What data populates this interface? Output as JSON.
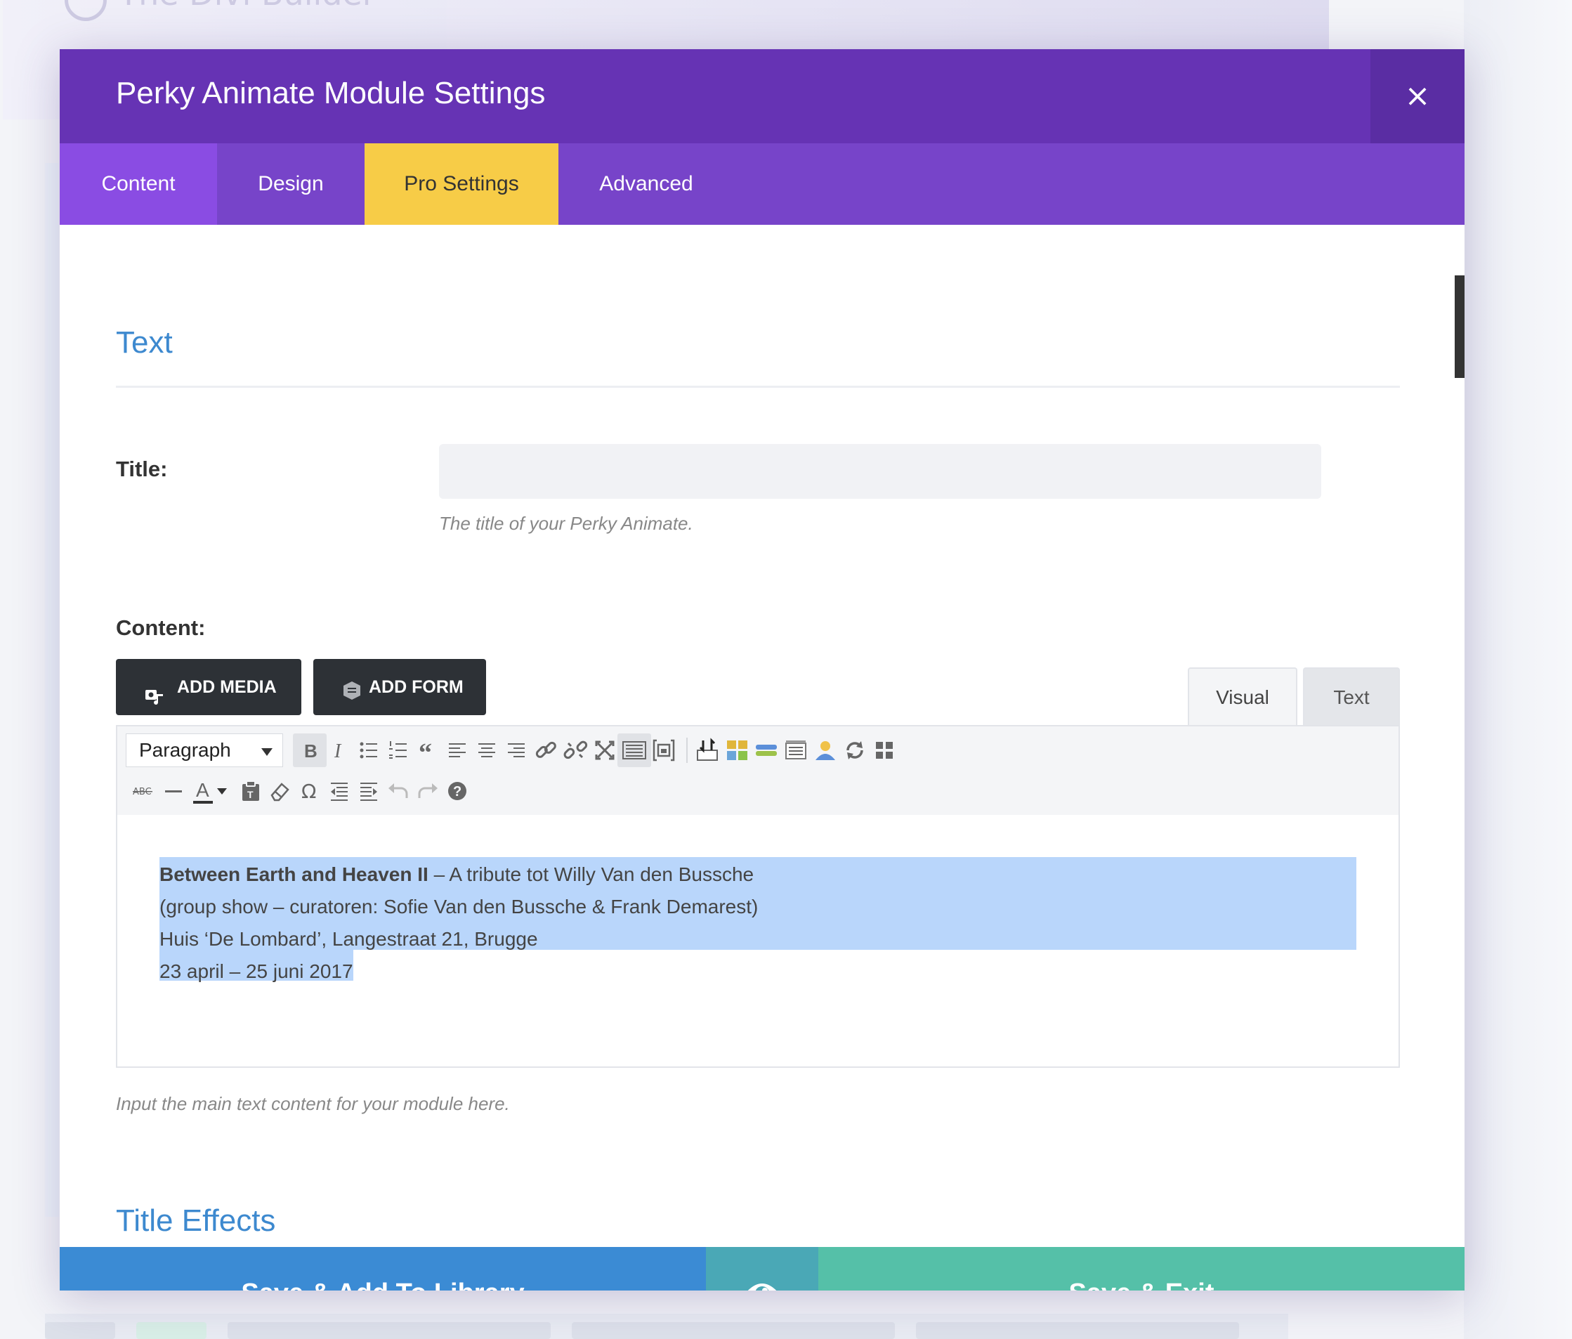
{
  "background": {
    "builder_title": "The Divi Builder"
  },
  "modal": {
    "title": "Perky Animate Module Settings",
    "close_glyph": "×",
    "tabs": [
      {
        "label": "Content"
      },
      {
        "label": "Design"
      },
      {
        "label": "Pro Settings",
        "active": true
      },
      {
        "label": "Advanced"
      }
    ]
  },
  "text_section": {
    "heading": "Text",
    "title_label": "Title:",
    "title_value": "",
    "title_desc": "The title of your Perky Animate.",
    "content_label": "Content:",
    "add_media": "ADD MEDIA",
    "add_form": "ADD FORM",
    "visual_tab": "Visual",
    "text_tab": "Text",
    "format_select": "Paragraph",
    "content_lines": [
      {
        "bold": "Between Earth and Heaven II",
        "rest": " – A tribute tot Willy Van den Bussche"
      },
      {
        "bold": "",
        "rest": "(group show – curatoren: Sofie Van den Bussche & Frank Demarest)"
      },
      {
        "bold": "",
        "rest": "Huis ‘De Lombard’, Langestraat 21, Brugge"
      },
      {
        "bold": "",
        "rest": "23 april – 25 juni 2017"
      }
    ],
    "content_desc": "Input the main text content for your module here."
  },
  "title_effects": {
    "heading": "Title Effects"
  },
  "footer": {
    "save_library": "Save & Add To Library",
    "save_exit": "Save & Exit"
  },
  "colors": {
    "header": "#6633b4",
    "tabs_bar": "#7744c9",
    "active_tab": "#f7cc47",
    "section_heading": "#3d89cf",
    "save_library": "#3b8bd4",
    "preview": "#4aa8b6",
    "save_exit": "#55c0a8"
  }
}
